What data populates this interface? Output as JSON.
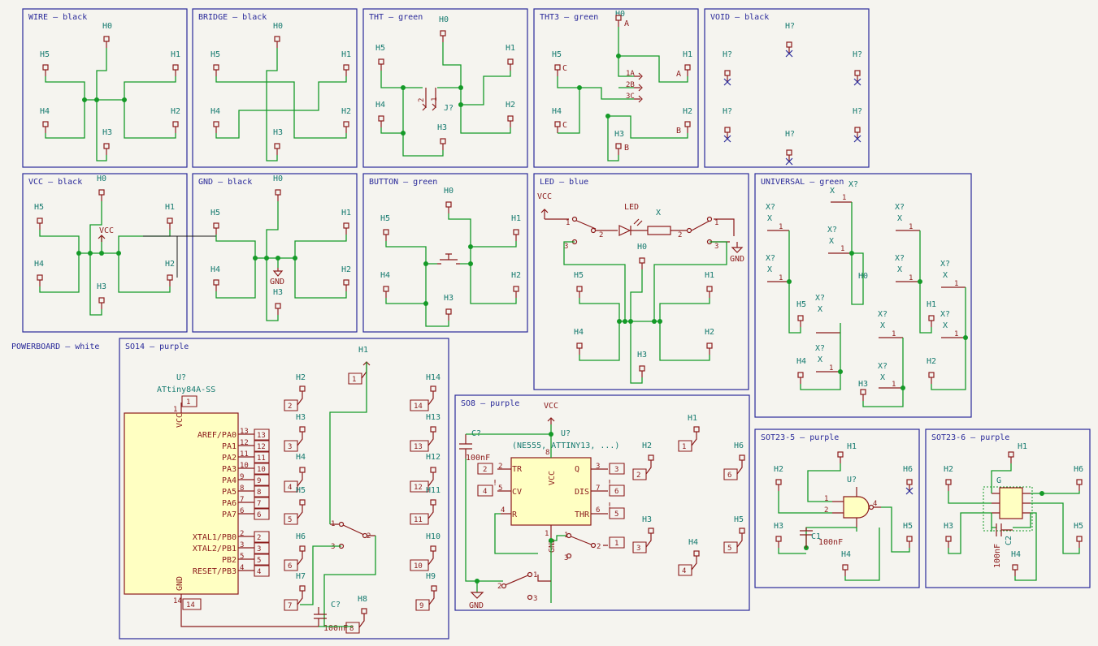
{
  "frames": [
    {
      "id": "wire",
      "title": "WIRE — black"
    },
    {
      "id": "bridge",
      "title": "BRIDGE — black"
    },
    {
      "id": "tht",
      "title": "THT — green"
    },
    {
      "id": "tht3",
      "title": "THT3 — green"
    },
    {
      "id": "void",
      "title": "VOID — black"
    },
    {
      "id": "vcc",
      "title": "VCC — black"
    },
    {
      "id": "gnd",
      "title": "GND — black"
    },
    {
      "id": "button",
      "title": "BUTTON — green"
    },
    {
      "id": "led",
      "title": "LED — blue"
    },
    {
      "id": "universal",
      "title": "UNIVERSAL — green"
    },
    {
      "id": "powerboard",
      "title": "POWERBOARD — white"
    },
    {
      "id": "so14",
      "title": "SO14 — purple"
    },
    {
      "id": "so8",
      "title": "SO8 — purple"
    },
    {
      "id": "sot235",
      "title": "SOT23-5 — purple"
    },
    {
      "id": "sot236",
      "title": "SOT23-6 — purple"
    }
  ],
  "labels": {
    "h0": "H0",
    "h1": "H1",
    "h2": "H2",
    "h3": "H3",
    "h4": "H4",
    "h5": "H5",
    "h6": "H6",
    "h7": "H7",
    "h8": "H8",
    "h9": "H9",
    "h10": "H10",
    "h11": "H11",
    "h12": "H12",
    "h13": "H13",
    "h14": "H14",
    "hq": "H?",
    "vcc": "VCC",
    "gnd": "GND",
    "led": "LED",
    "x": "X",
    "xq": "X?",
    "jq": "J?",
    "uq": "U?",
    "cq": "C?",
    "c1": "C1",
    "c2": "C2",
    "cap": "100nF",
    "a": "A",
    "b": "B",
    "c": "C",
    "a1": "1A",
    "b2": "2B",
    "c3": "3C",
    "so14_part": "ATtiny84A-SS",
    "so8_part": "(NE555, ATTINY13, ...)",
    "g": "G",
    "so14_left": [
      "AREF/PA0",
      "PA1",
      "PA2",
      "PA3",
      "PA4",
      "PA5",
      "PA6",
      "PA7",
      "XTAL1/PB0",
      "XTAL2/PB1",
      "PB2",
      "RESET/PB3"
    ],
    "so14_left_nums": [
      "13",
      "12",
      "11",
      "10",
      "9",
      "8",
      "7",
      "6",
      "2",
      "3",
      "5",
      "4"
    ],
    "so8_pins": {
      "tr": "TR",
      "cv": "CV",
      "r": "R",
      "q": "Q",
      "dis": "DIS",
      "thr": "THR",
      "vcc": "VCC",
      "gnd": "GND"
    },
    "excl": "!"
  }
}
